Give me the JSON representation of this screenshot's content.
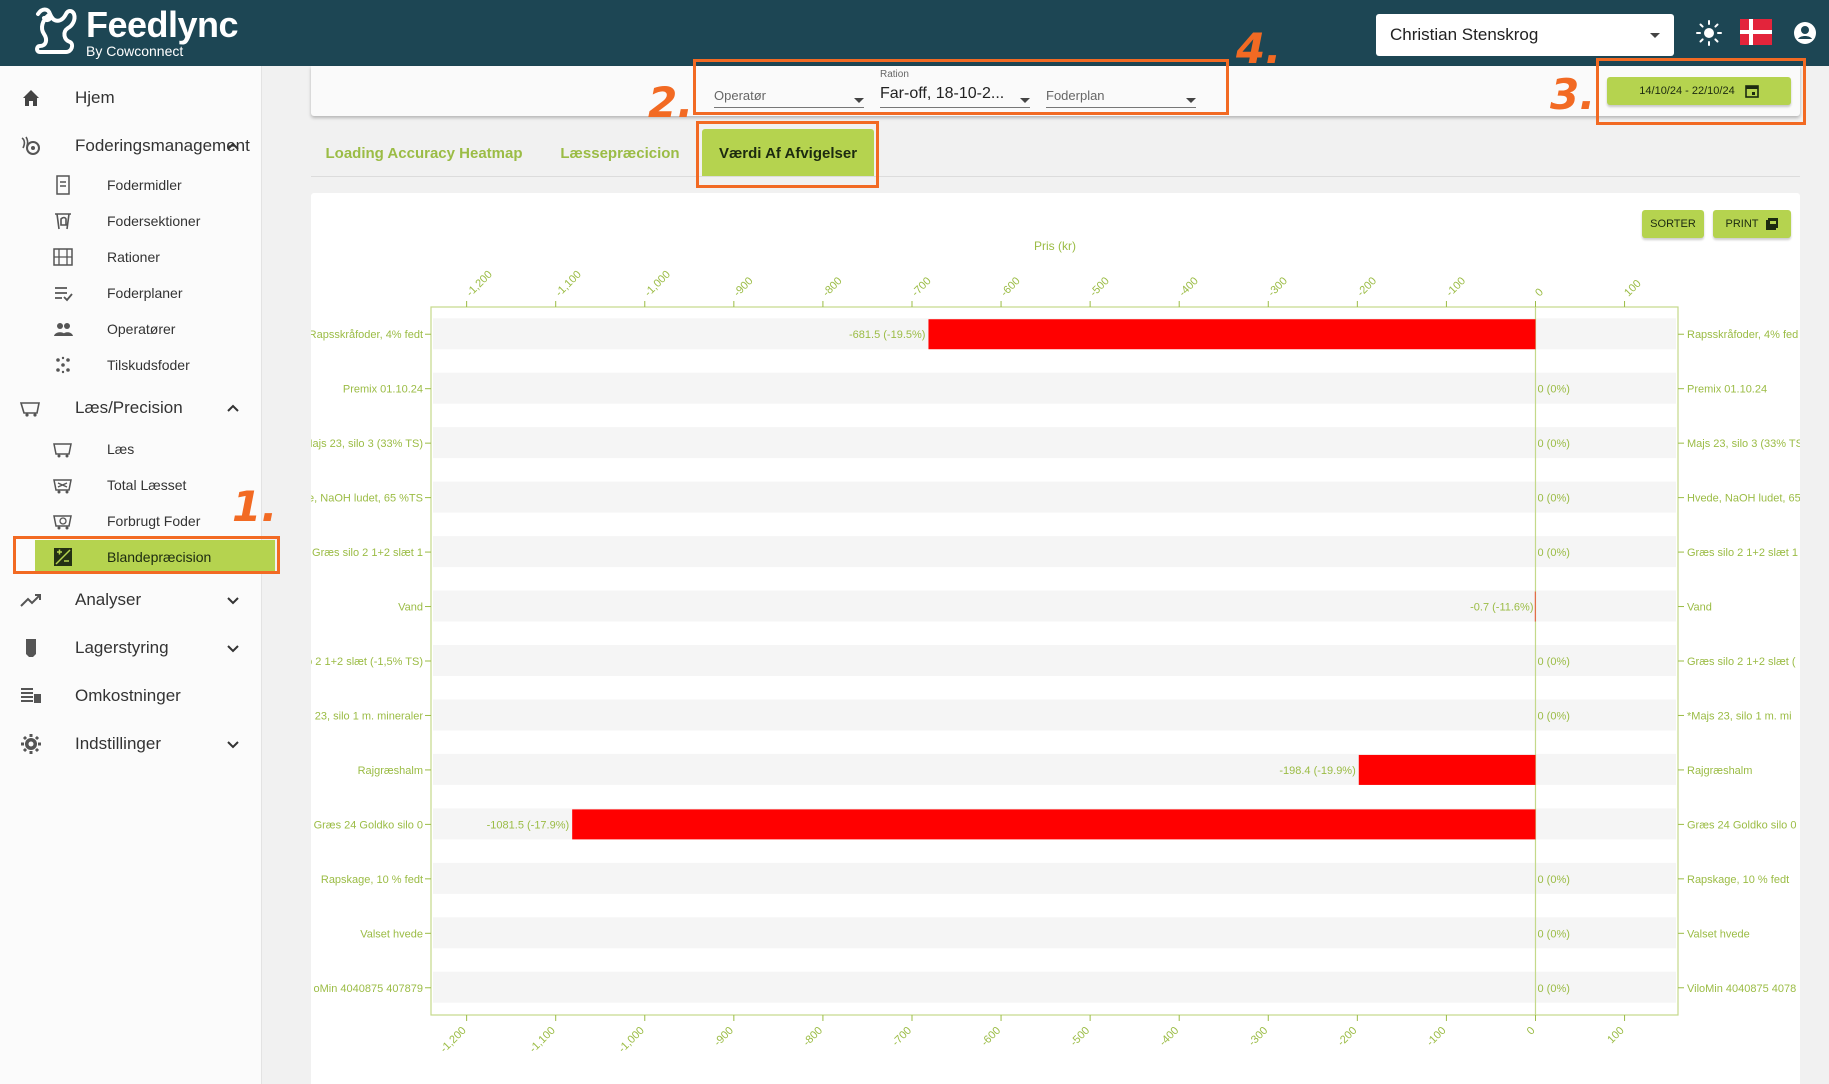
{
  "app": {
    "title": "Feedlync",
    "subtitle": "By Cowconnect"
  },
  "header": {
    "user": "Christian Stenskrog"
  },
  "sidebar": {
    "home": "Hjem",
    "feeding": "Foderingsmanagement",
    "feeding_items": [
      "Fodermidler",
      "Fodersektioner",
      "Rationer",
      "Foderplaner",
      "Operatører",
      "Tilskudsfoder"
    ],
    "loading": "Læs/Precision",
    "loading_items": [
      "Læs",
      "Total Læsset",
      "Forbrugt Foder",
      "Blandepræcision"
    ],
    "analyses": "Analyser",
    "stock": "Lagerstyring",
    "costs": "Omkostninger",
    "settings": "Indstillinger"
  },
  "filters": {
    "operator_label": "Operatør",
    "ration_label": "Ration",
    "ration_value": "Far-off, 18-10-2...",
    "feedplan_label": "Foderplan",
    "date_range": "14/10/24 - 22/10/24"
  },
  "tabs": [
    "Loading Accuracy Heatmap",
    "Læssepræcicion",
    "Værdi Af Afvigelser"
  ],
  "buttons": {
    "sort": "SORTER",
    "print": "PRINT"
  },
  "annotations": [
    "1.",
    "2.",
    "3.",
    "4."
  ],
  "colors": {
    "header": "#1d4654",
    "accent": "#b5d34f",
    "bar": "#ff0000",
    "annotation": "#f26a23",
    "axis": "#9bbc45"
  },
  "chart_data": {
    "type": "bar",
    "orientation": "horizontal",
    "xlabel": "Pris (kr)",
    "xlim": [
      -1240,
      160
    ],
    "xticks": [
      -1200,
      -1100,
      -1000,
      -900,
      -800,
      -700,
      -600,
      -500,
      -400,
      -300,
      -200,
      -100,
      0,
      100
    ],
    "xtick_labels": [
      "-1,200",
      "-1,100",
      "-1,000",
      "-900",
      "-800",
      "-700",
      "-600",
      "-500",
      "-400",
      "-300",
      "-200",
      "-100",
      "0",
      "100"
    ],
    "categories_left": [
      "Rapsskråfoder, 4% fedt",
      "Premix 01.10.24",
      "Majs 23, silo 3 (33% TS)",
      "e, NaOH ludet, 65 %TS",
      "Græs silo 2 1+2 slæt 1",
      "Vand",
      "o 2 1+2 slæt (-1,5% TS)",
      "23, silo 1 m. mineraler",
      "Rajgræshalm",
      "Græs 24 Goldko silo 0",
      "Rapskage, 10 % fedt",
      "Valset hvede",
      "oMin 4040875 407879"
    ],
    "categories_right": [
      "Rapsskråfoder, 4% fed",
      "Premix 01.10.24",
      "Majs 23, silo 3 (33% TS",
      "Hvede, NaOH ludet, 65",
      "Græs silo 2 1+2 slæt 1",
      "Vand",
      "Græs silo 2 1+2 slæt (",
      "*Majs 23, silo 1 m. mi",
      "Rajgræshalm",
      "Græs 24 Goldko silo 0",
      "Rapskage, 10 % fedt",
      "Valset hvede",
      "ViloMin 4040875 4078"
    ],
    "values": [
      -681.5,
      0,
      0,
      0,
      0,
      -0.7,
      0,
      0,
      -198.4,
      -1081.5,
      0,
      0,
      0
    ],
    "labels": [
      "-681.5 (-19.5%)",
      "0 (0%)",
      "0 (0%)",
      "0 (0%)",
      "0 (0%)",
      "-0.7 (-11.6%)",
      "0 (0%)",
      "0 (0%)",
      "-198.4 (-19.9%)",
      "-1081.5 (-17.9%)",
      "0 (0%)",
      "0 (0%)",
      "0 (0%)"
    ],
    "grid": false,
    "legend": "none"
  }
}
